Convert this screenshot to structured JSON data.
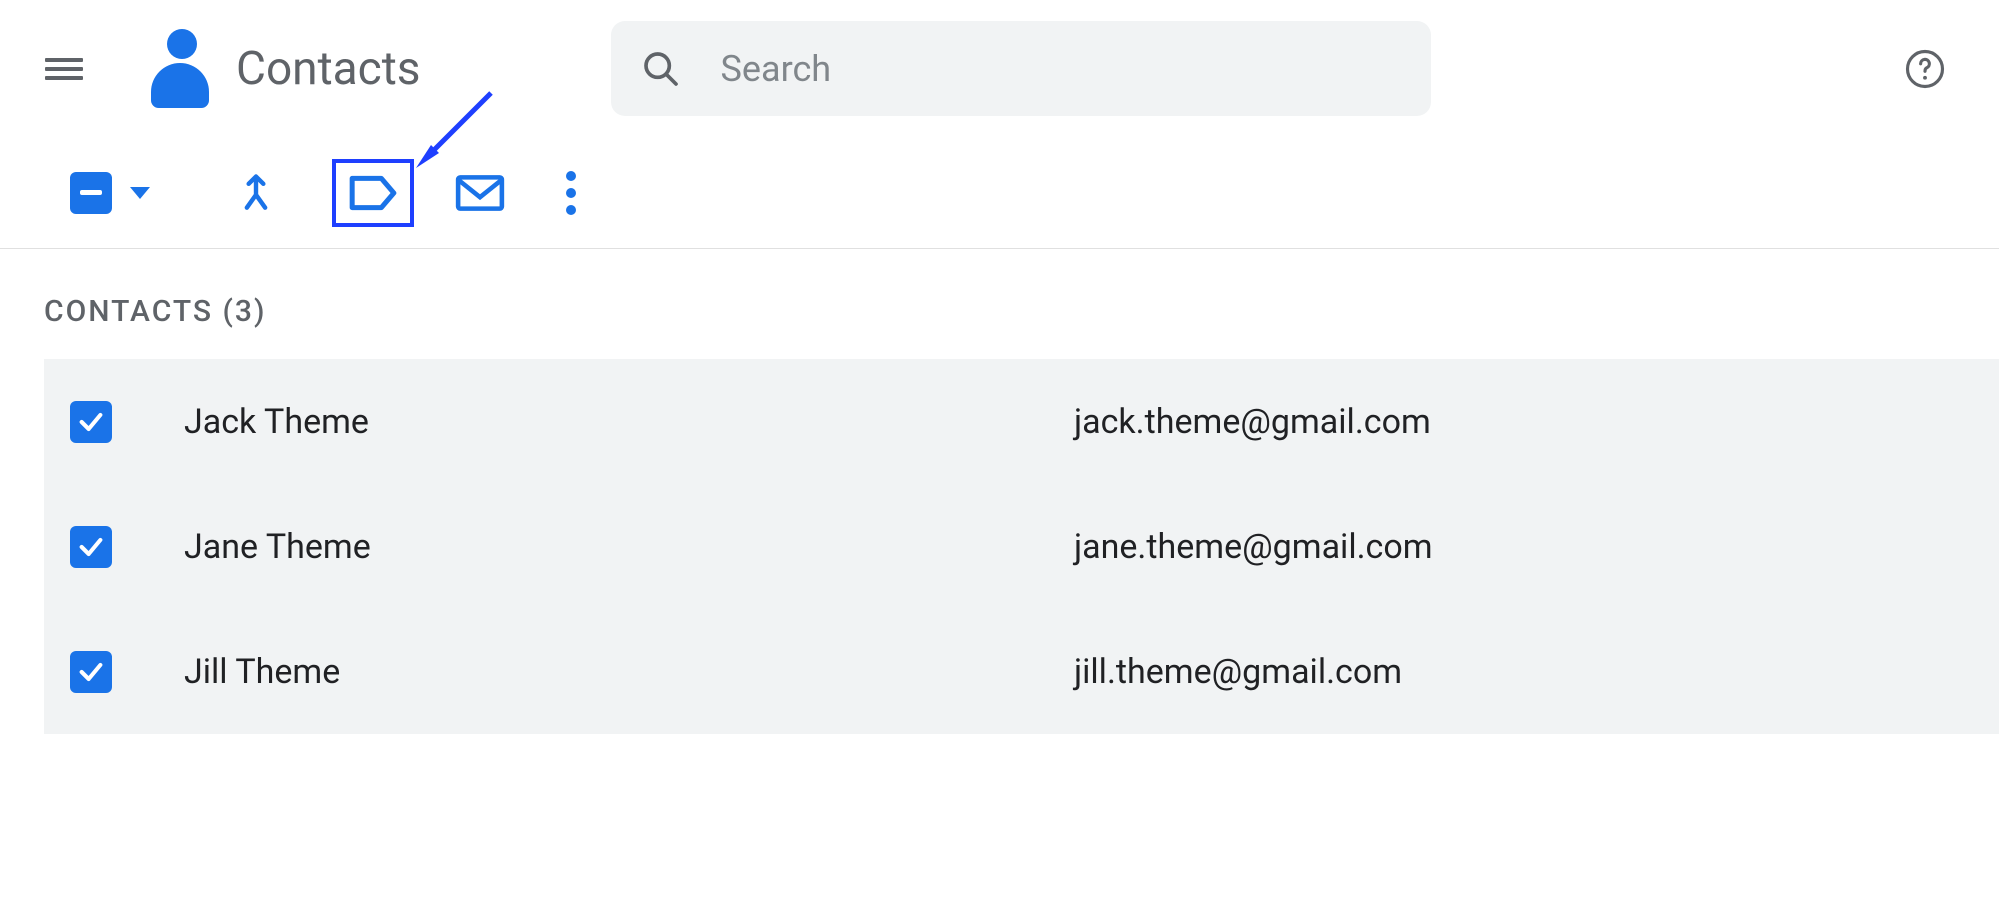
{
  "app": {
    "title": "Contacts"
  },
  "search": {
    "placeholder": "Search"
  },
  "section": {
    "header": "CONTACTS (3)"
  },
  "contacts": [
    {
      "name": "Jack Theme",
      "email": "jack.theme@gmail.com",
      "checked": true
    },
    {
      "name": "Jane Theme",
      "email": "jane.theme@gmail.com",
      "checked": true
    },
    {
      "name": "Jill Theme",
      "email": "jill.theme@gmail.com",
      "checked": true
    }
  ],
  "selection": {
    "state": "partial"
  },
  "annotation": {
    "highlighted_action": "manage-labels"
  }
}
